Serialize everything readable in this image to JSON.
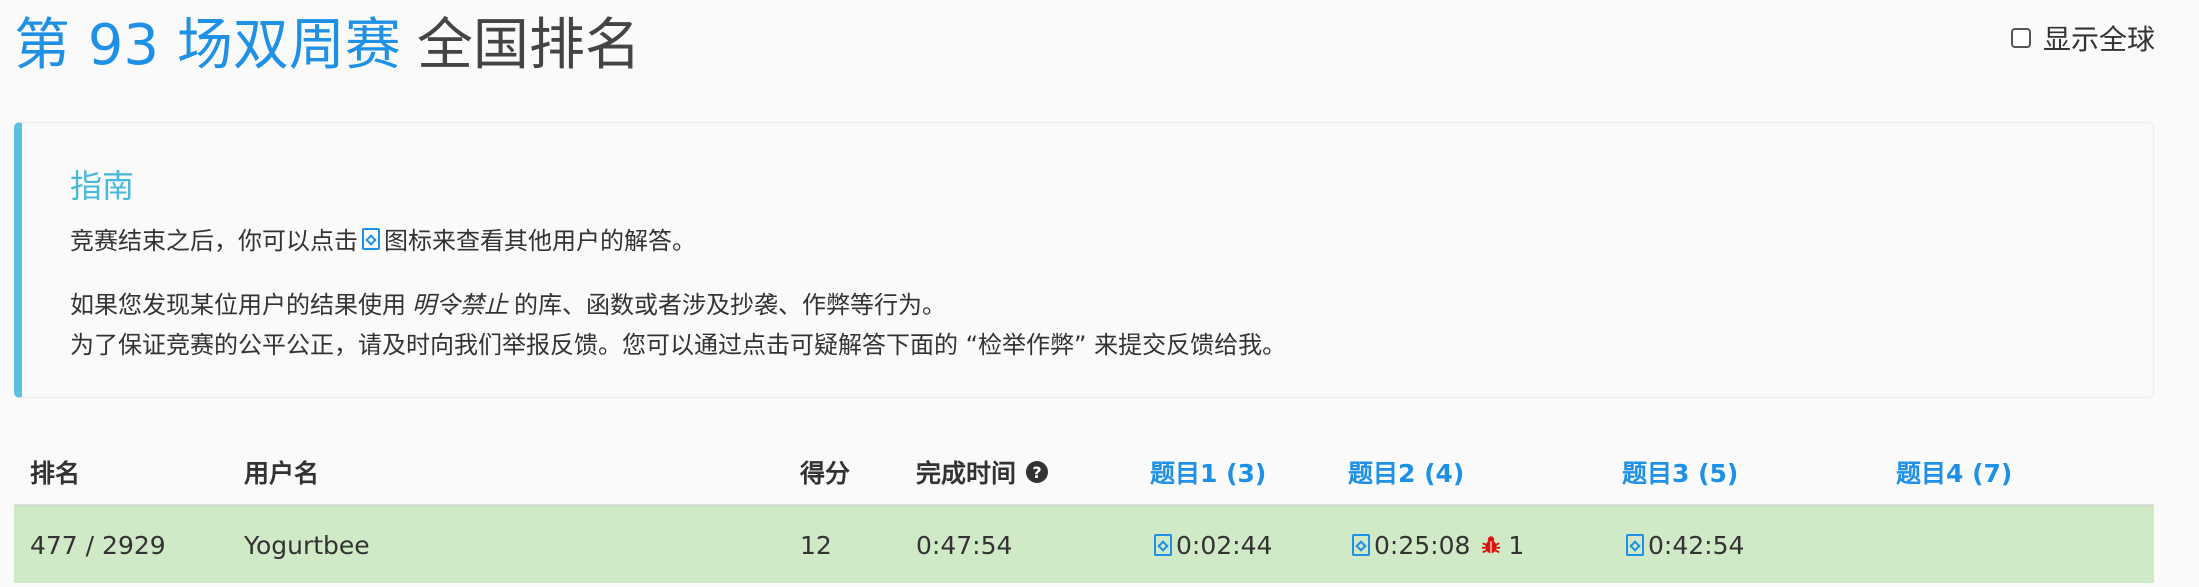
{
  "header": {
    "contest_name": "第 93 场双周赛",
    "page_label": "全国排名",
    "show_global_label": "显示全球"
  },
  "guide": {
    "title": "指南",
    "line1_before": "竞赛结束之后，你可以点击",
    "line1_after": "图标来查看其他用户的解答。",
    "line2_before": "如果您发现某位用户的结果使用",
    "line2_em": "明令禁止",
    "line2_after": "的库、函数或者涉及抄袭、作弊等行为。",
    "line3": "为了保证竞赛的公平公正，请及时向我们举报反馈。您可以通过点击可疑解答下面的 “检举作弊” 来提交反馈给我。"
  },
  "table": {
    "headers": {
      "rank": "排名",
      "username": "用户名",
      "score": "得分",
      "finish_time": "完成时间",
      "q1": "题目1 (3)",
      "q2": "题目2 (4)",
      "q3": "题目3 (5)",
      "q4": "题目4 (7)"
    },
    "rows": [
      {
        "rank": "477 / 2929",
        "username": "Yogurtbee",
        "score": "12",
        "finish_time": "0:47:54",
        "q1": "0:02:44",
        "q2": "0:25:08",
        "q2_penalty": "1",
        "q3": "0:42:54",
        "q4": ""
      }
    ]
  },
  "icons": {
    "code": "code-file-icon",
    "help": "question-circle-icon",
    "bug": "bug-icon"
  },
  "colors": {
    "contest_title": "#1e90e6",
    "guide_accent": "#5bc0de",
    "row_highlight": "#d0e9c6",
    "bug": "#d9140f"
  }
}
